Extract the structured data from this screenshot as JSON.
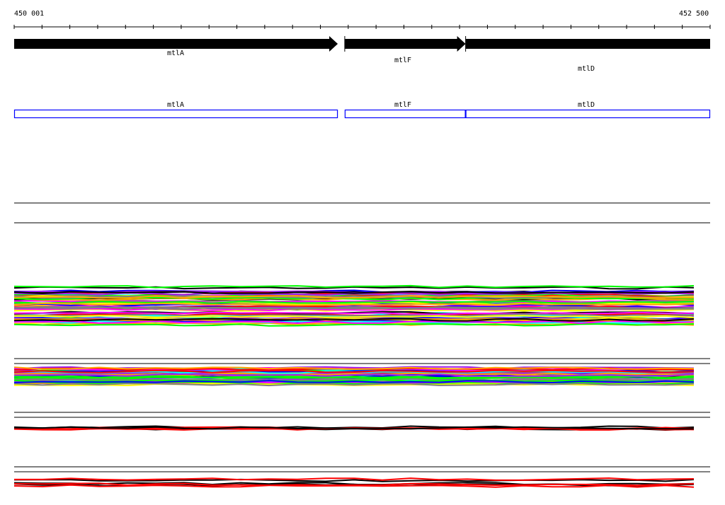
{
  "ruler": {
    "start_label": "450 001",
    "end_label": "452 500",
    "start": 450001,
    "end": 452500,
    "tick_count": 26
  },
  "genes": [
    {
      "name": "mtlA",
      "start": 450001,
      "end": 451163,
      "strand": "+"
    },
    {
      "name": "mtlF",
      "start": 451188,
      "end": 451622,
      "strand": "+"
    },
    {
      "name": "mtlD",
      "start": 451622,
      "end": 452500,
      "strand": "+"
    }
  ],
  "colors": {
    "gene": "#000000",
    "annotation_box": "#0000ff",
    "track_palette": [
      "#ff0000",
      "#00ff00",
      "#0000ff",
      "#ff00ff",
      "#00ffff",
      "#ffa500",
      "#000000",
      "#808080",
      "#ffff00",
      "#a020f0"
    ]
  }
}
